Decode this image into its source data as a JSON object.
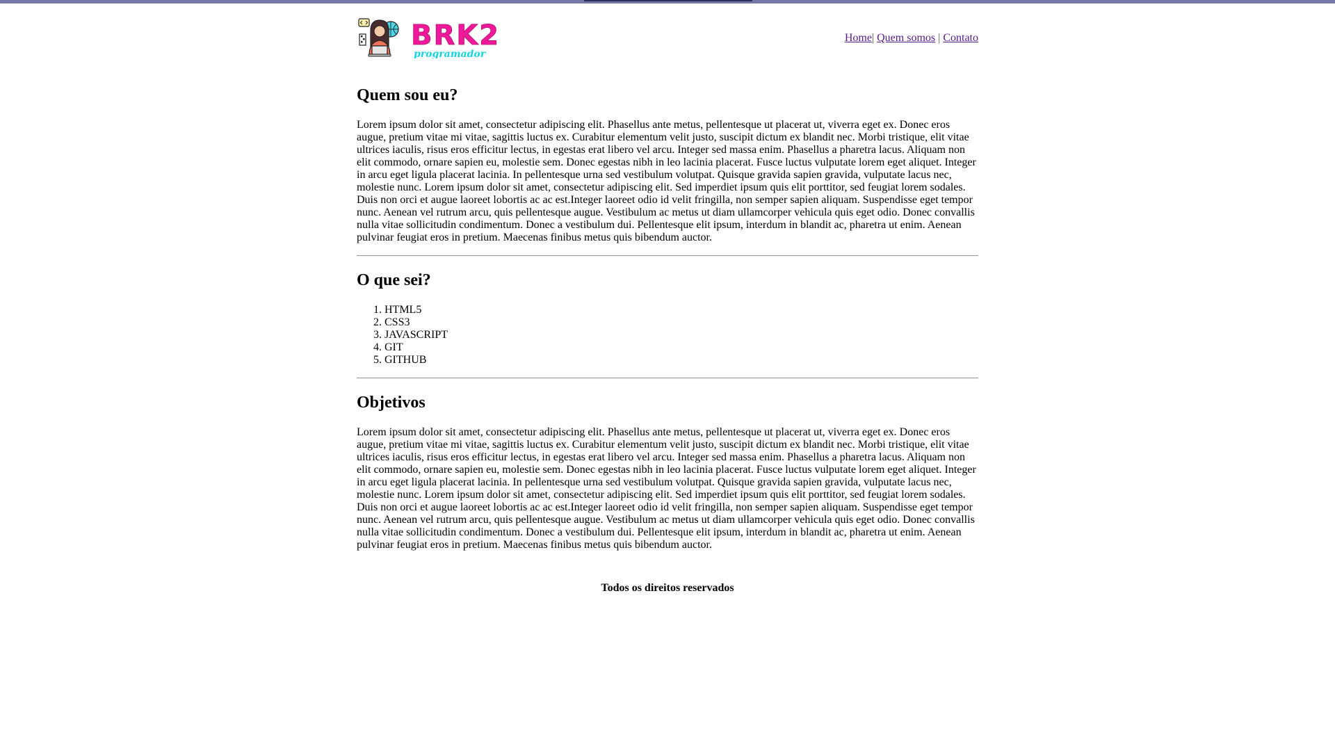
{
  "colors": {
    "top_bar": "#7478a8",
    "link": "#551a8b",
    "logo_pink": "#f0189a",
    "logo_cyan": "#12d4e0",
    "divider": "#9a9a9a"
  },
  "logo": {
    "brand": "BRK2",
    "tagline": "programador",
    "icon": "programmer-avatar-icon"
  },
  "nav": {
    "home": "Home",
    "separator1": "|",
    "quem_somos": "Quem somos",
    "separator2": "|",
    "contato": "Contato"
  },
  "sections": {
    "about": {
      "title": "Quem sou eu?",
      "text": "Lorem ipsum dolor sit amet, consectetur adipiscing elit. Phasellus ante metus, pellentesque ut placerat ut, viverra eget ex. Donec eros augue, pretium vitae mi vitae, sagittis luctus ex. Curabitur elementum velit justo, suscipit dictum ex blandit nec. Morbi tristique, elit vitae ultrices iaculis, risus eros efficitur lectus, in egestas erat libero vel arcu. Integer sed massa enim. Phasellus a pharetra lacus. Aliquam non elit commodo, ornare sapien eu, molestie sem. Donec egestas nibh in leo lacinia placerat. Fusce luctus vulputate lorem eget aliquet. Integer in arcu eget ligula placerat lacinia. In pellentesque urna sed vestibulum volutpat. Quisque gravida sapien gravida, vulputate lacus nec, molestie nunc. Lorem ipsum dolor sit amet, consectetur adipiscing elit. Sed imperdiet ipsum quis elit porttitor, sed feugiat lorem sodales. Duis non orci et augue laoreet lobortis ac ac est.Integer laoreet odio id velit fringilla, non semper sapien aliquam. Suspendisse eget tempor nunc. Aenean vel rutrum arcu, quis pellentesque augue. Vestibulum ac metus ut diam ullamcorper vehicula quis eget odio. Donec convallis nulla vitae sollicitudin condimentum. Donec a vestibulum dui. Pellentesque elit ipsum, interdum in blandit ac, pharetra ut enim. Aenean pulvinar feugiat eros in pretium. Maecenas finibus metus quis bibendum auctor."
    },
    "skills": {
      "title": "O que sei?",
      "items": [
        "HTML5",
        "CSS3",
        "JAVASCRIPT",
        "GIT",
        "GITHUB"
      ]
    },
    "goals": {
      "title": "Objetivos",
      "text": "Lorem ipsum dolor sit amet, consectetur adipiscing elit. Phasellus ante metus, pellentesque ut placerat ut, viverra eget ex. Donec eros augue, pretium vitae mi vitae, sagittis luctus ex. Curabitur elementum velit justo, suscipit dictum ex blandit nec. Morbi tristique, elit vitae ultrices iaculis, risus eros efficitur lectus, in egestas erat libero vel arcu. Integer sed massa enim. Phasellus a pharetra lacus. Aliquam non elit commodo, ornare sapien eu, molestie sem. Donec egestas nibh in leo lacinia placerat. Fusce luctus vulputate lorem eget aliquet. Integer in arcu eget ligula placerat lacinia. In pellentesque urna sed vestibulum volutpat. Quisque gravida sapien gravida, vulputate lacus nec, molestie nunc. Lorem ipsum dolor sit amet, consectetur adipiscing elit. Sed imperdiet ipsum quis elit porttitor, sed feugiat lorem sodales. Duis non orci et augue laoreet lobortis ac ac est.Integer laoreet odio id velit fringilla, non semper sapien aliquam. Suspendisse eget tempor nunc. Aenean vel rutrum arcu, quis pellentesque augue. Vestibulum ac metus ut diam ullamcorper vehicula quis eget odio. Donec convallis nulla vitae sollicitudin condimentum. Donec a vestibulum dui. Pellentesque elit ipsum, interdum in blandit ac, pharetra ut enim. Aenean pulvinar feugiat eros in pretium. Maecenas finibus metus quis bibendum auctor."
    }
  },
  "footer": {
    "text": "Todos os direitos reservados"
  }
}
